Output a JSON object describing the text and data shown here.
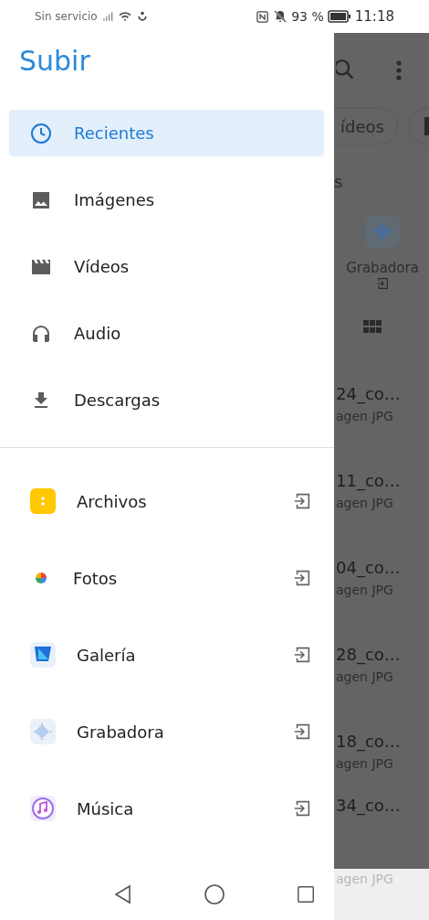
{
  "status_bar": {
    "carrier": "Sin servicio",
    "battery": "93 %",
    "time": "11:18"
  },
  "drawer": {
    "title": "Subir",
    "locations": [
      {
        "label": "Recientes",
        "kind": "clock",
        "selected": true
      },
      {
        "label": "Imágenes",
        "kind": "image",
        "selected": false
      },
      {
        "label": "Vídeos",
        "kind": "film",
        "selected": false
      },
      {
        "label": "Audio",
        "kind": "headphones",
        "selected": false
      },
      {
        "label": "Descargas",
        "kind": "download",
        "selected": false
      }
    ],
    "apps": [
      {
        "label": "Archivos",
        "kind": "files"
      },
      {
        "label": "Fotos",
        "kind": "photos"
      },
      {
        "label": "Galería",
        "kind": "gallery"
      },
      {
        "label": "Grabadora",
        "kind": "recorder"
      },
      {
        "label": "Música",
        "kind": "music"
      }
    ]
  },
  "background": {
    "chips": [
      "ídeos"
    ],
    "section_heading": "s",
    "shortcut_label": "Grabadora",
    "files": [
      {
        "name": "24_co…",
        "type": "agen JPG"
      },
      {
        "name": "11_co…",
        "type": "agen JPG"
      },
      {
        "name": "04_co…",
        "type": "agen JPG"
      },
      {
        "name": "28_co…",
        "type": "agen JPG"
      },
      {
        "name": "18_co…",
        "type": "agen JPG"
      },
      {
        "name": "34_co…",
        "type": "agen JPG"
      }
    ]
  }
}
